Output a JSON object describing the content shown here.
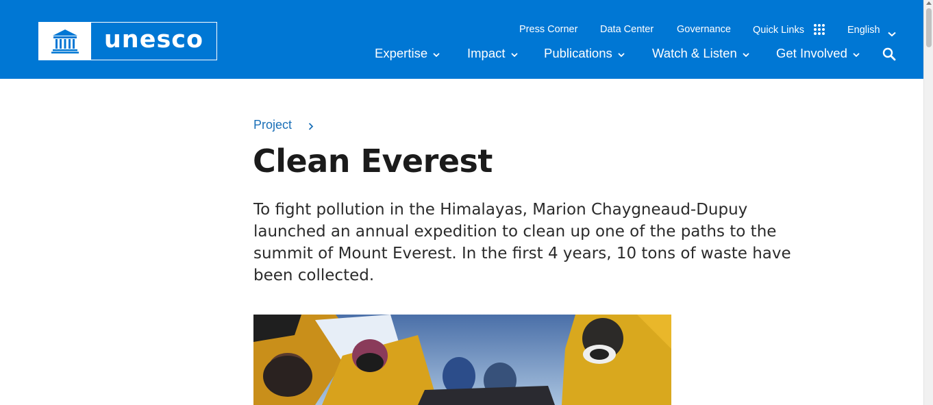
{
  "brand": {
    "name": "unesco"
  },
  "utility_nav": {
    "press_corner": "Press Corner",
    "data_center": "Data Center",
    "governance": "Governance",
    "quick_links": "Quick Links",
    "language": "English"
  },
  "main_nav": {
    "expertise": "Expertise",
    "impact": "Impact",
    "publications": "Publications",
    "watch_listen": "Watch & Listen",
    "get_involved": "Get Involved"
  },
  "breadcrumb": {
    "label": "Project"
  },
  "article": {
    "title": "Clean Everest",
    "lede": "To fight pollution in the Himalayas, Marion Chaygneaud-Dupuy launched an annual expedition to clean up one of the paths to the summit of Mount Everest. In the first 4 years, 10 tons of waste have been collected."
  },
  "icons": [
    "unesco-temple-icon",
    "grid-icon",
    "chevron-down-icon",
    "search-icon",
    "chevron-right-icon"
  ],
  "colors": {
    "header_bg": "#0077d4",
    "link": "#1a6fb7",
    "title": "#1b1b1b",
    "body_text": "#2b2b2b"
  }
}
